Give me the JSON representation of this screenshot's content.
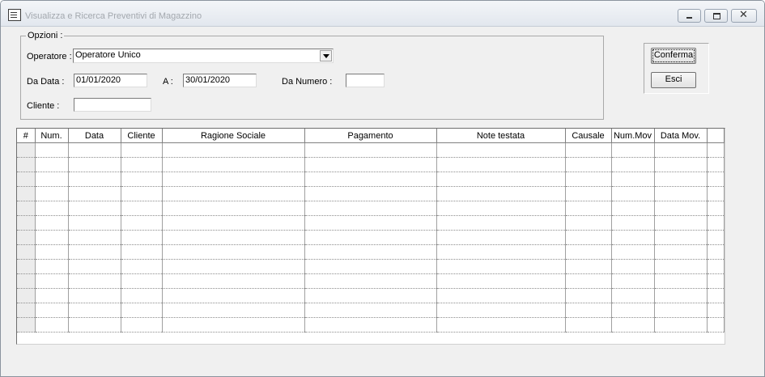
{
  "window": {
    "title": "Visualizza e Ricerca Preventivi di Magazzino"
  },
  "options": {
    "group_title": "Opzioni :",
    "operatore_label": "Operatore :",
    "operatore_value": "Operatore Unico",
    "da_data_label": "Da Data :",
    "da_data_value": "01/01/2020",
    "a_label": "A :",
    "a_value": "30/01/2020",
    "da_numero_label": "Da Numero :",
    "da_numero_value": "",
    "cliente_label": "Cliente :",
    "cliente_value": ""
  },
  "buttons": {
    "conferma": "Conferma",
    "esci": "Esci"
  },
  "grid": {
    "columns": [
      "#",
      "Num.",
      "Data",
      "Cliente",
      "Ragione Sociale",
      "Pagamento",
      "Note testata",
      "Causale",
      "Num.Mov",
      "Data Mov.",
      ""
    ],
    "row_count": 13
  }
}
